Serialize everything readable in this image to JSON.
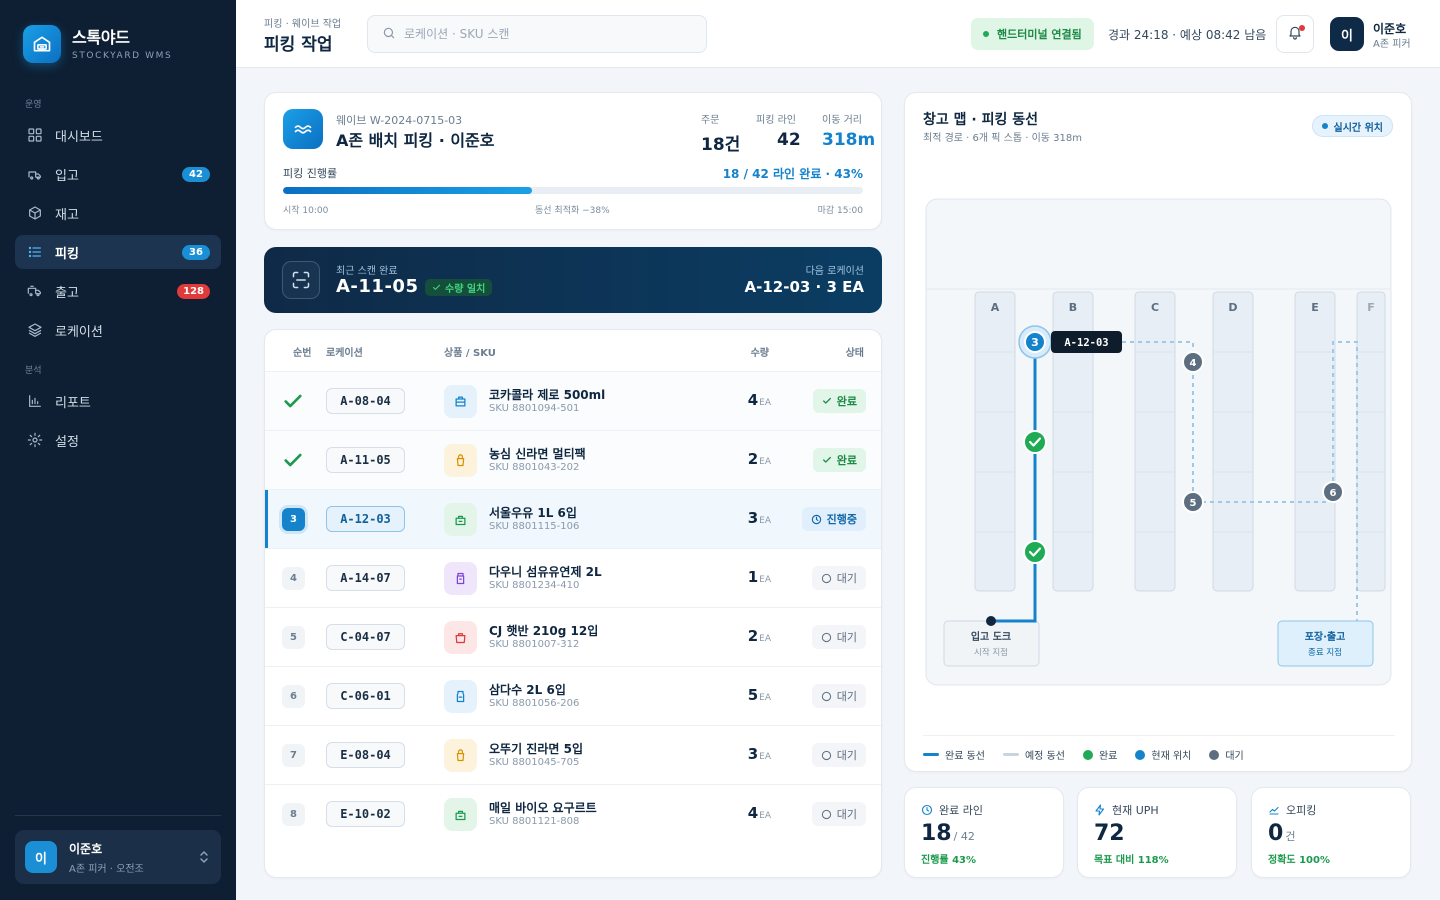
{
  "brand": {
    "name": "스톡야드",
    "sub": "STOCKYARD WMS"
  },
  "sidebar": {
    "section_ops": "운영",
    "section_analysis": "분석",
    "items": [
      {
        "label": "대시보드",
        "icon": "grid-icon",
        "badge": ""
      },
      {
        "label": "입고",
        "icon": "inbound-truck-icon",
        "badge": "42"
      },
      {
        "label": "재고",
        "icon": "box-icon",
        "badge": ""
      },
      {
        "label": "피킹",
        "icon": "list-icon",
        "badge": "36"
      },
      {
        "label": "출고",
        "icon": "outbound-truck-icon",
        "badge": "128"
      },
      {
        "label": "로케이션",
        "icon": "layers-icon",
        "badge": ""
      },
      {
        "label": "리포트",
        "icon": "bar-chart-icon",
        "badge": ""
      },
      {
        "label": "설정",
        "icon": "gear-icon",
        "badge": ""
      }
    ],
    "user": {
      "initial": "이",
      "name": "이준호",
      "role": "A존 피커 · 오전조"
    }
  },
  "header": {
    "breadcrumb": "피킹 · 웨이브 작업",
    "title": "피킹 작업",
    "search_placeholder": "로케이션 · SKU 스캔",
    "connection": "핸드터미널 연결됨",
    "timer": "경과 24:18 · 예상 08:42 남음",
    "user_initial": "이",
    "user_name": "이준호",
    "user_role": "A존 피커"
  },
  "wave": {
    "id": "웨이브 W-2024-0715-03",
    "title": "A존 배치 피킹 · 이준호",
    "stats": [
      {
        "label": "주문",
        "value": "18건"
      },
      {
        "label": "피킹 라인",
        "value": "42"
      },
      {
        "label": "이동 거리",
        "value": "318m"
      }
    ],
    "progress_label": "피킹 진행률",
    "progress_summary": "18 / 42 라인 완료 · 43%",
    "progress_pct": 43,
    "start": "시작 10:00",
    "optimize": "동선 최적화 −38%",
    "deadline": "마감 15:00"
  },
  "scan": {
    "label": "최근 스캔 완료",
    "location": "A-11-05",
    "badge": "수량 일치",
    "next_label": "다음 로케이션",
    "next": "A-12-03 · 3 EA"
  },
  "table": {
    "headers": {
      "seq": "순번",
      "location": "로케이션",
      "product": "상품 / SKU",
      "qty": "수량",
      "status": "상태"
    },
    "unit": "EA",
    "rows": [
      {
        "seq": "1",
        "location": "A-08-04",
        "name": "코카콜라 제로 500ml",
        "sku": "SKU 8801094-501",
        "qty": "4",
        "status": "완료",
        "state": "done",
        "color": "#1583cc",
        "bg": "#e5f2fc"
      },
      {
        "seq": "2",
        "location": "A-11-05",
        "name": "농심 신라면 멀티팩",
        "sku": "SKU 8801043-202",
        "qty": "2",
        "status": "완료",
        "state": "done",
        "color": "#d99100",
        "bg": "#fdf3dc"
      },
      {
        "seq": "3",
        "location": "A-12-03",
        "name": "서울우유 1L 6입",
        "sku": "SKU 8801115-106",
        "qty": "3",
        "status": "진행중",
        "state": "current",
        "color": "#1b9a4d",
        "bg": "#e3f5e9"
      },
      {
        "seq": "4",
        "location": "A-14-07",
        "name": "다우니 섬유유연제 2L",
        "sku": "SKU 8801234-410",
        "qty": "1",
        "status": "대기",
        "state": "wait",
        "color": "#7e44d6",
        "bg": "#efe6fb"
      },
      {
        "seq": "5",
        "location": "C-04-07",
        "name": "CJ 햇반 210g 12입",
        "sku": "SKU 8801007-312",
        "qty": "2",
        "status": "대기",
        "state": "wait",
        "color": "#d93b3b",
        "bg": "#fde6e6"
      },
      {
        "seq": "6",
        "location": "C-06-01",
        "name": "삼다수 2L 6입",
        "sku": "SKU 8801056-206",
        "qty": "5",
        "status": "대기",
        "state": "wait",
        "color": "#1583cc",
        "bg": "#e5f2fc"
      },
      {
        "seq": "7",
        "location": "E-08-04",
        "name": "오뚜기 진라면 5입",
        "sku": "SKU 8801045-705",
        "qty": "3",
        "status": "대기",
        "state": "wait",
        "color": "#d99100",
        "bg": "#fdf3dc"
      },
      {
        "seq": "8",
        "location": "E-10-02",
        "name": "매일 바이오 요구르트",
        "sku": "SKU 8801121-808",
        "qty": "4",
        "status": "대기",
        "state": "wait",
        "color": "#1b9a4d",
        "bg": "#e3f5e9"
      }
    ]
  },
  "map": {
    "title": "창고 맵 · 피킹 동선",
    "sub": "최적 경로 · 6개 픽 스톱 · 이동 318m",
    "live": "실시간 위치",
    "aisles": [
      "A",
      "B",
      "C",
      "D",
      "E",
      "F"
    ],
    "current_label": "A-12-03",
    "current_num": "3",
    "stops": [
      "4",
      "5",
      "6"
    ],
    "dock_in": "입고 도크",
    "dock_in_sub": "시작 지점",
    "dock_out": "포장·출고",
    "dock_out_sub": "종료 지점",
    "legend": [
      "완료 동선",
      "예정 동선",
      "완료",
      "현재 위치",
      "대기"
    ],
    "colors": {
      "done": "#1583cc",
      "planned": "#c9d4df",
      "complete": "#1faa55",
      "current": "#1583cc",
      "wait": "#5d6e80"
    }
  },
  "kpis": [
    {
      "label": "완료 라인",
      "value": "18",
      "suffix": "/ 42",
      "foot": "진행률 43%"
    },
    {
      "label": "현재 UPH",
      "value": "72",
      "suffix": "",
      "foot": "목표 대비 118%"
    },
    {
      "label": "오피킹",
      "value": "0",
      "suffix": "건",
      "foot": "정확도 100%"
    }
  ]
}
